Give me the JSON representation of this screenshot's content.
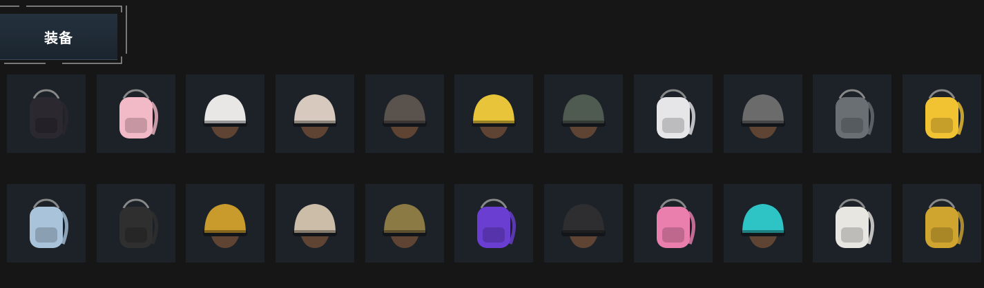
{
  "category_tab": {
    "label": "装备"
  },
  "rows": [
    {
      "items": [
        {
          "icon": "backpack-dark-icon",
          "color": "#2b2830"
        },
        {
          "icon": "backpack-pink-icon",
          "color": "#f2b9c6"
        },
        {
          "icon": "helmet-dalmatian-icon",
          "color": "#e9e6e6"
        },
        {
          "icon": "helmet-red-white-icon",
          "color": "#d7c9bd"
        },
        {
          "icon": "helmet-spiked-icon",
          "color": "#5a524d"
        },
        {
          "icon": "helmet-bee-antennae-icon",
          "color": "#e8c43a"
        },
        {
          "icon": "helmet-camo-icon",
          "color": "#4f5a50"
        },
        {
          "icon": "backpack-white-icon",
          "color": "#e6e6e8"
        },
        {
          "icon": "helmet-horned-icon",
          "color": "#6b6b6b"
        },
        {
          "icon": "backpack-tactical-icon",
          "color": "#6a6f74"
        },
        {
          "icon": "backpack-bee-wings-icon",
          "color": "#f1c232"
        }
      ]
    },
    {
      "items": [
        {
          "icon": "backpack-shark-icon",
          "color": "#a9c3da"
        },
        {
          "icon": "backpack-black-icon",
          "color": "#2f2f2f"
        },
        {
          "icon": "helmet-gold-visor-icon",
          "color": "#c99a2c"
        },
        {
          "icon": "helmet-cream-icon",
          "color": "#cbbda7"
        },
        {
          "icon": "helmet-gold-mesh-icon",
          "color": "#8c7a45"
        },
        {
          "icon": "backpack-purple-icon",
          "color": "#6a3ed1"
        },
        {
          "icon": "helmet-black-visor-icon",
          "color": "#2e2e30"
        },
        {
          "icon": "backpack-pink-ribbon-icon",
          "color": "#ea7fae"
        },
        {
          "icon": "helmet-teal-visor-icon",
          "color": "#2ec4c6"
        },
        {
          "icon": "backpack-white-orange-icon",
          "color": "#e8e6e1"
        },
        {
          "icon": "backpack-black-gold-icon",
          "color": "#cfa42f"
        }
      ]
    }
  ]
}
